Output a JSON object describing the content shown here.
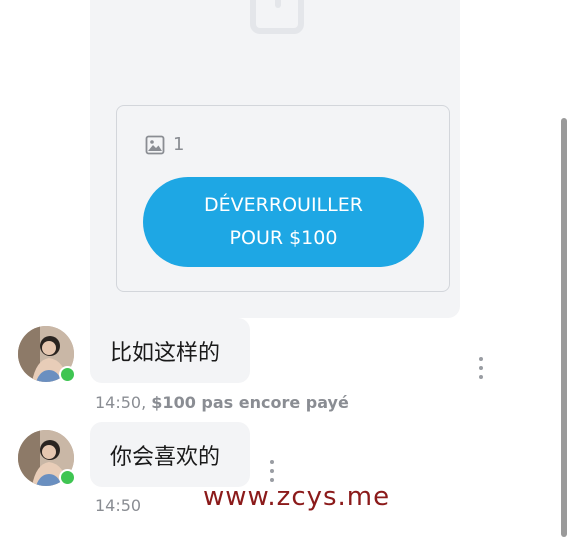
{
  "locked_post": {
    "media_count": "1",
    "unlock_line1": "DÉVERROUILLER",
    "unlock_line2": "POUR $100"
  },
  "messages": [
    {
      "text": "比如这样的",
      "time": "14:50,",
      "price_status": "$100 pas encore payé"
    },
    {
      "text": "你会喜欢的",
      "time": "14:50"
    }
  ],
  "watermark": "www.zcys.me",
  "colors": {
    "accent": "#1ea7e4",
    "online": "#3fc552",
    "bubble": "#f3f4f6",
    "muted_text": "#8a8d93"
  },
  "icons": [
    "lock-icon",
    "image-icon",
    "more-options-icon"
  ]
}
